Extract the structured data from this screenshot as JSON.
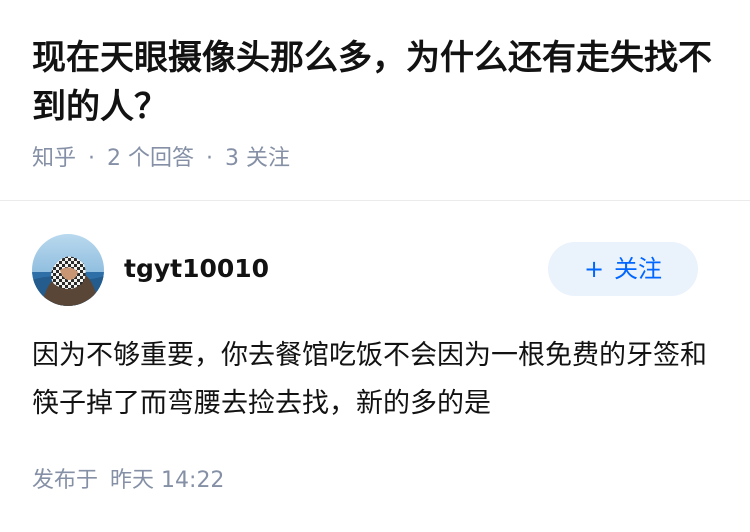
{
  "question": {
    "title": "现在天眼摄像头那么多，为什么还有走失找不到的人？",
    "source": "知乎",
    "separator": "·",
    "answer_count": "2",
    "answer_count_label": "个回答",
    "follow_count": "3",
    "follow_count_label": "关注"
  },
  "answer": {
    "author": {
      "name": "tgyt10010"
    },
    "follow_button": {
      "plus": "+",
      "label": "关注"
    },
    "content": "因为不够重要，你去餐馆吃饭不会因为一根免费的牙签和筷子掉了而弯腰去捡去找，新的多的是",
    "footer": {
      "published_label": "发布于",
      "published_day": "昨天",
      "published_time": "14:22"
    }
  },
  "colors": {
    "title": "#121212",
    "meta": "#8590a6",
    "accent": "#0066ff",
    "follow_bg": "#eaf2fc",
    "divider": "#ebebeb"
  },
  "icons": {
    "avatar": "user-avatar-photo"
  }
}
